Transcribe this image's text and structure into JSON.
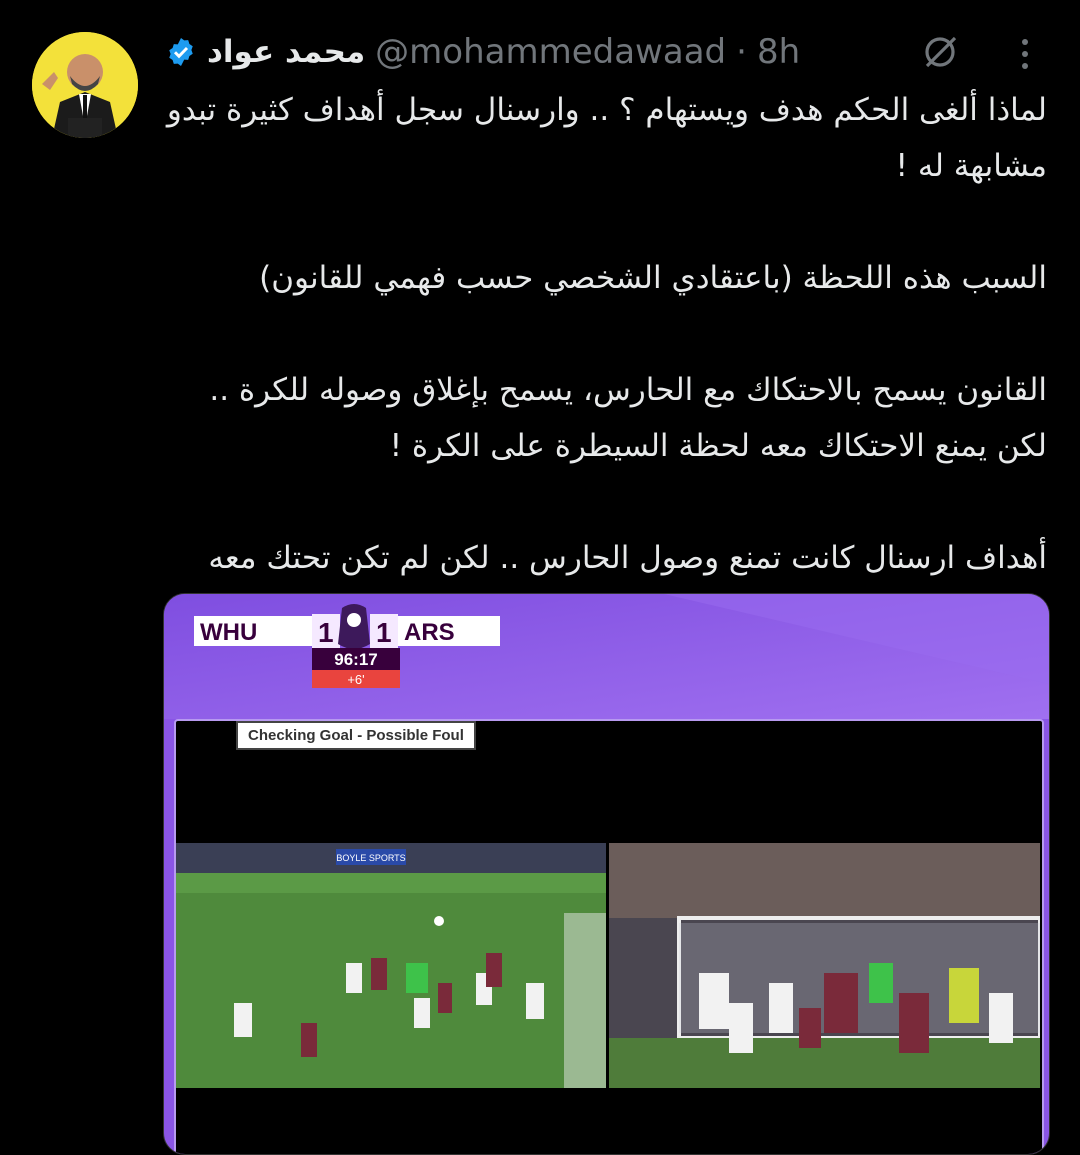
{
  "tweet": {
    "author_name": "محمد عواد",
    "handle": "@mohammedawaad",
    "separator": "·",
    "time": "8h",
    "paragraphs": [
      "لماذا ألغى الحكم هدف ويستهام ؟ .. وارسنال سجل أهداف كثيرة تبدو مشابهة له !",
      "السبب هذه اللحظة (باعتقادي الشخصي حسب فهمي للقانون)",
      "القانون يسمح بالاحتكاك مع الحارس، يسمح بإغلاق وصوله للكرة .. لكن يمنع الاحتكاك معه لحظة السيطرة على الكرة !",
      "أهداف ارسنال كانت تمنع وصول الحارس .. لكن لم تكن تحتك معه لحظة السيطرة"
    ]
  },
  "media": {
    "scoreboard": {
      "home": "WHU",
      "home_score": "1",
      "away_score": "1",
      "away": "ARS",
      "clock": "96:17",
      "added": "+6'"
    },
    "banner": "Checking Goal - Possible Foul",
    "ad_board": "BOYLE SPORTS"
  },
  "colors": {
    "background": "#000000",
    "text": "#e7e9ea",
    "muted": "#71767b",
    "verified": "#1d9bf0",
    "media_purple": "#8a55e6"
  }
}
